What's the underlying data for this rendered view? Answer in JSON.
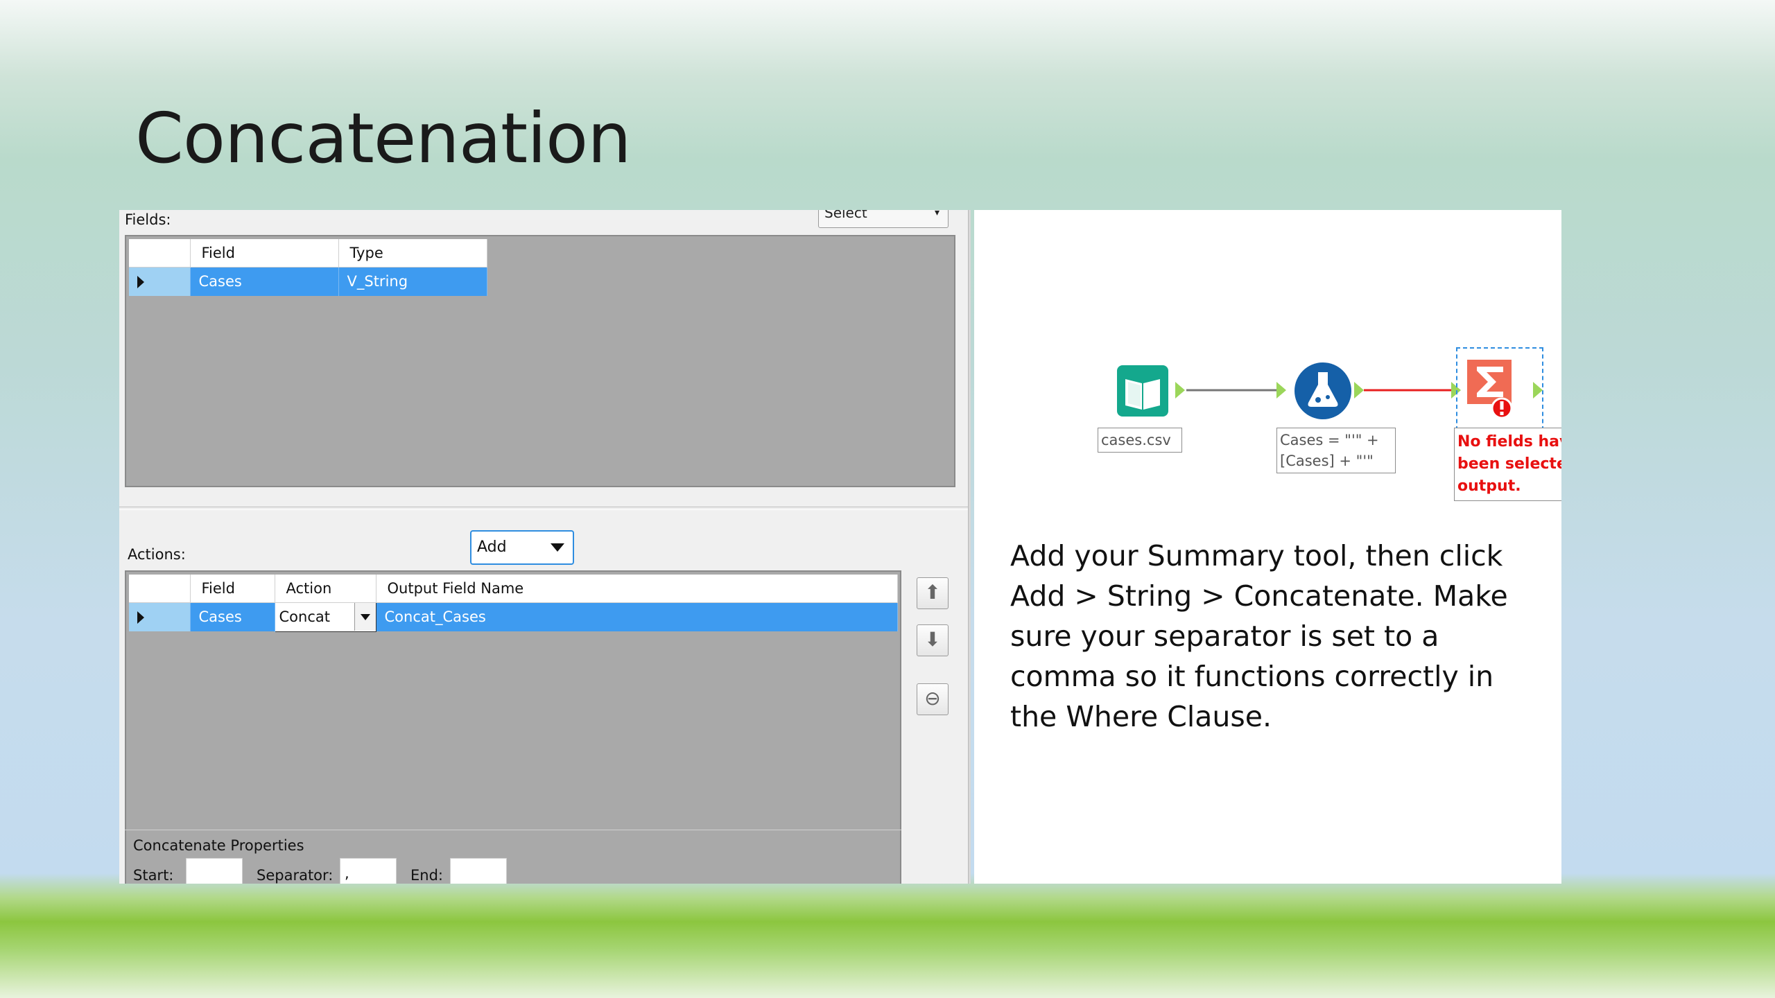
{
  "slide": {
    "title": "Concatenation"
  },
  "dialog": {
    "fields_label": "Fields:",
    "select_stub": "Select",
    "fields_table": {
      "headers": [
        "Field",
        "Type"
      ],
      "rows": [
        {
          "field": "Cases",
          "type": "V_String"
        }
      ]
    },
    "actions_label": "Actions:",
    "add_button": "Add",
    "actions_table": {
      "headers": [
        "Field",
        "Action",
        "Output Field Name"
      ],
      "rows": [
        {
          "field": "Cases",
          "action": "Concat",
          "output": "Concat_Cases"
        }
      ]
    },
    "concat_props": {
      "title": "Concatenate Properties",
      "start_label": "Start:",
      "start_value": "",
      "separator_label": "Separator:",
      "separator_value": ",",
      "end_label": "End:",
      "end_value": ""
    }
  },
  "workflow": {
    "input_label": "cases.csv",
    "formula_label": [
      "Cases = \"'\" +",
      "[Cases] + \"'\""
    ],
    "summary_error": [
      "No fields have",
      "been selected",
      "output."
    ]
  },
  "description": "Add your Summary tool, then click Add > String > Concatenate.  Make sure your separator is set to a comma so it functions correctly in the Where Clause."
}
